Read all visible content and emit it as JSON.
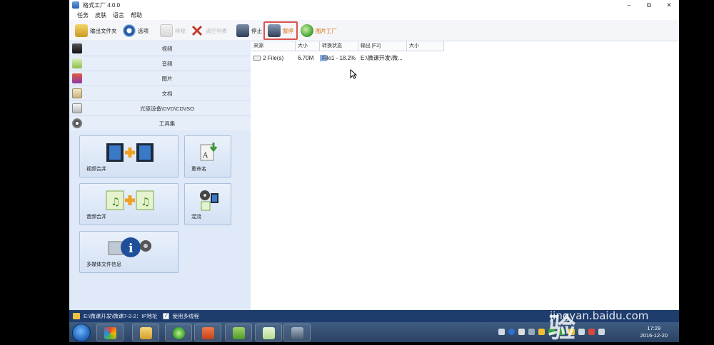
{
  "window": {
    "title": "格式工厂 4.0.0",
    "controls": [
      "–",
      "⧉",
      "✕"
    ]
  },
  "menu": [
    "任务",
    "皮肤",
    "语言",
    "帮助"
  ],
  "toolbar": {
    "output_folder": "输出文件夹",
    "options": "选项",
    "remove": "移除",
    "clear_list": "清空列表",
    "stop": "停止",
    "pause": "暂停",
    "picture_factory": "图片工厂"
  },
  "sidebar": {
    "categories": [
      "视频",
      "音频",
      "图片",
      "文档",
      "光驱设备\\DVD\\CD\\ISO",
      "工具集"
    ],
    "tools": [
      {
        "label": "视频合并"
      },
      {
        "label": "重命名"
      },
      {
        "label": "音频合并"
      },
      {
        "label": "混流"
      },
      {
        "label": "多媒体文件信息"
      }
    ]
  },
  "filelist": {
    "columns": [
      "来源",
      "大小",
      "转换状态",
      "输出 [F2]",
      "大小"
    ],
    "rows": [
      {
        "source": "2 File(s)",
        "size": "6.70M",
        "status": "File1 - 18.2%",
        "progress": 0.182,
        "output": "E:\\微课开发\\微...",
        "out_size": ""
      }
    ]
  },
  "status_bar": {
    "path": "E:\\微课开发\\微课7-2-2：IP地址",
    "multithread_label": "使用多线程",
    "multithread_checked": "✓"
  },
  "taskbar": {
    "time": "17:29",
    "date": "2016-12-20"
  },
  "watermark": {
    "brand": "Baidu经验",
    "site": "jingyan.baidu.com"
  }
}
